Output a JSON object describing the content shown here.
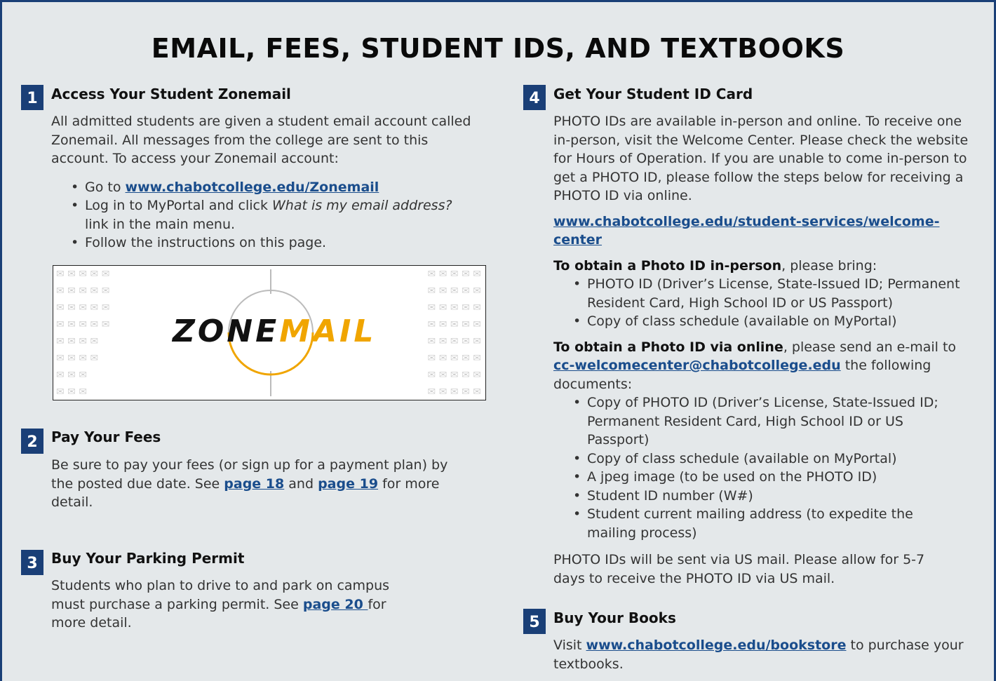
{
  "title": "EMAIL, FEES, STUDENT IDS, AND TEXTBOOKS",
  "colors": {
    "accent": "#1a3f77",
    "link": "#1a4d8c",
    "zonemail_gold": "#f0a500"
  },
  "sections": {
    "s1": {
      "num": "1",
      "heading": "Access Your Student Zonemail",
      "intro": "All admitted students are given a student email account called Zonemail. All messages from the college are sent to this account. To access your Zonemail account:",
      "b1_pre": "Go to ",
      "b1_link": "www.chabotcollege.edu/Zonemail",
      "b2_pre": "Log in to MyPortal and click ",
      "b2_ital": "What is my email address?",
      "b2_post": " link in the main menu.",
      "b3": "Follow the instructions on this page.",
      "logo_zone": "ZONE",
      "logo_mail": "MAIL"
    },
    "s2": {
      "num": "2",
      "heading": "Pay Your Fees",
      "t1": "Be sure to pay your fees (or sign up for a payment plan) by the posted due date.  See ",
      "link1": "page 18",
      "t2": " and ",
      "link2": "page 19",
      "t3": " for more detail."
    },
    "s3": {
      "num": "3",
      "heading": "Buy Your Parking Permit",
      "t1": "Students who plan to drive to and park on campus must purchase a parking permit.  See ",
      "link1": "page 20 ",
      "t2": "for more detail."
    },
    "s4": {
      "num": "4",
      "heading": "Get Your Student ID Card",
      "intro": "PHOTO IDs are available in-person and online. To receive one in-person, visit the Welcome Center. Please check the website for Hours of Operation. If you are unable to come in-person to get a PHOTO ID, please follow the steps below for receiving a PHOTO ID via online.",
      "url": "www.chabotcollege.edu/student-services/welcome-center",
      "inperson_bold": "To obtain a Photo ID in-person",
      "inperson_rest": ", please bring:",
      "inperson_items": [
        "PHOTO ID (Driver’s License, State-Issued ID; Permanent Resident Card, High School ID or US Passport)",
        "Copy of class schedule (available on MyPortal)"
      ],
      "online_bold": "To obtain a Photo ID via online",
      "online_rest": ", please send an e-mail to ",
      "online_email": "cc-welcomecenter@chabotcollege.edu",
      "online_post": " the following documents:",
      "online_items": [
        "Copy of PHOTO ID (Driver’s License, State-Issued ID; Permanent Resident Card, High School ID or US Passport)",
        "Copy of class schedule (available on MyPortal)",
        "A jpeg image (to be used on the PHOTO ID)",
        "Student ID number (W#)",
        "Student current mailing address (to expedite the mailing process)"
      ],
      "closing": "PHOTO IDs will be sent via US mail. Please allow for 5-7 days to receive the PHOTO ID via US mail."
    },
    "s5": {
      "num": "5",
      "heading": "Buy Your Books",
      "t1": "Visit ",
      "link1": "www.chabotcollege.edu/bookstore",
      "t2": " to purchase your textbooks."
    }
  }
}
